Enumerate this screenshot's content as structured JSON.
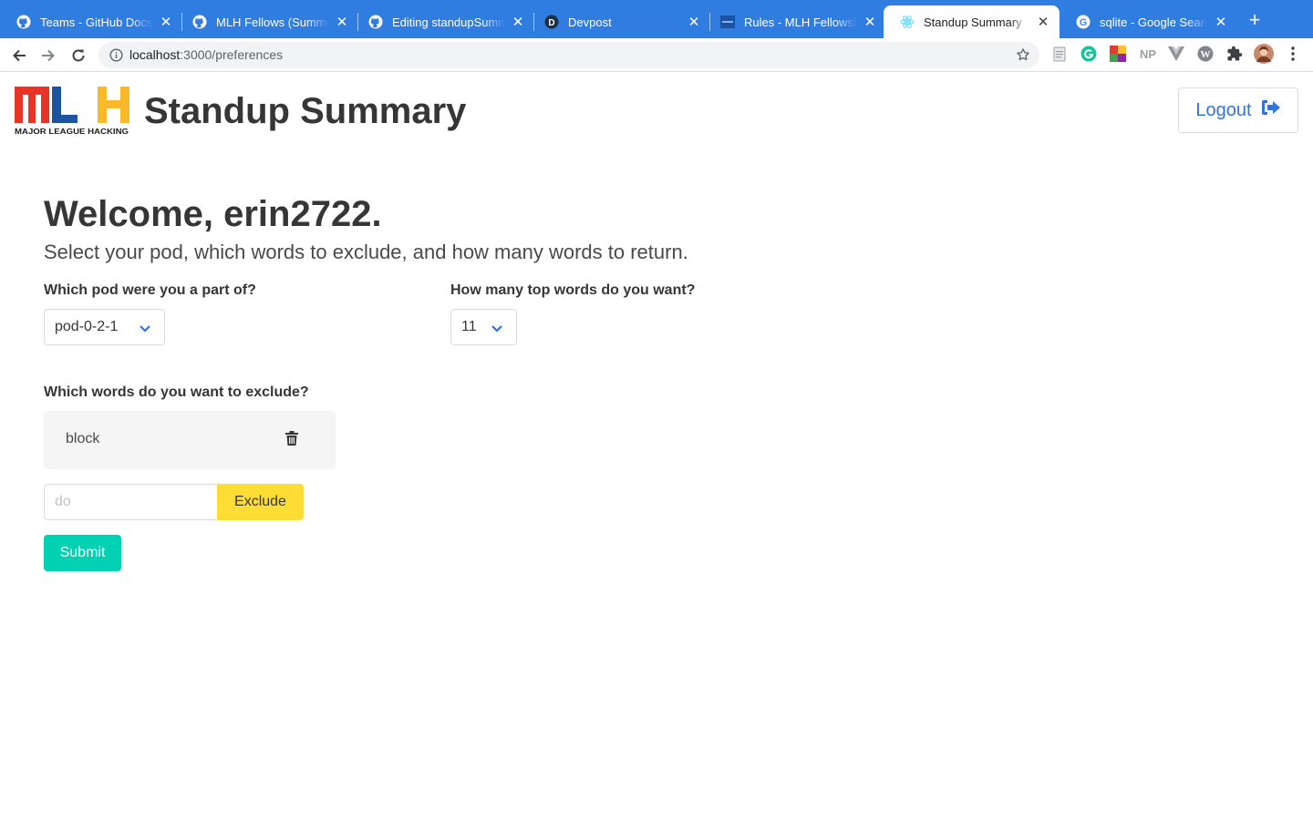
{
  "browser": {
    "tabs": [
      {
        "title": "Teams - GitHub Docs",
        "favicon": "github-icon"
      },
      {
        "title": "MLH Fellows (Summer",
        "favicon": "github-icon"
      },
      {
        "title": "Editing standupSumm",
        "favicon": "github-icon"
      },
      {
        "title": "Devpost",
        "favicon": "devpost-icon"
      },
      {
        "title": "Rules - MLH Fellowship",
        "favicon": "mlh-icon"
      },
      {
        "title": "Standup Summary",
        "favicon": "react-icon",
        "active": true
      },
      {
        "title": "sqlite - Google Search",
        "favicon": "google-icon"
      }
    ],
    "url_host": "localhost",
    "url_path": ":3000/preferences",
    "extensions": [
      "page-icon",
      "grammarly-icon",
      "color-extension-icon",
      "NP",
      "vue-devtools-icon",
      "wordpress-icon",
      "puzzle-icon",
      "profile-avatar",
      "menu-icon"
    ]
  },
  "header": {
    "logo_text": "MLH",
    "logo_subtext": "MAJOR LEAGUE HACKING",
    "app_title": "Standup Summary",
    "logout_label": "Logout"
  },
  "main": {
    "welcome": "Welcome, erin2722.",
    "subtitle": "Select your pod, which words to exclude, and how many words to return.",
    "pod_label": "Which pod were you a part of?",
    "pod_value": "pod-0-2-1",
    "count_label": "How many top words do you want?",
    "count_value": "11",
    "exclude_label": "Which words do you want to exclude?",
    "excluded_words": [
      "block"
    ],
    "exclude_placeholder": "do",
    "exclude_button": "Exclude",
    "submit_button": "Submit"
  },
  "colors": {
    "tabbar": "#2f7de1",
    "link": "#3273dc",
    "primary": "#00d1b2",
    "warning": "#ffdd35"
  }
}
